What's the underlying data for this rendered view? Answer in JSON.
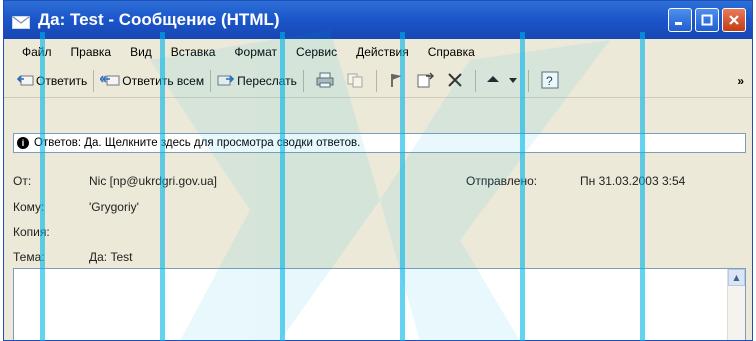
{
  "window": {
    "title": "Да: Test - Сообщение (HTML)"
  },
  "menu": [
    {
      "label": "Файл"
    },
    {
      "label": "Правка"
    },
    {
      "label": "Вид"
    },
    {
      "label": "Вставка"
    },
    {
      "label": "Формат"
    },
    {
      "label": "Сервис"
    },
    {
      "label": "Действия"
    },
    {
      "label": "Справка"
    }
  ],
  "toolbar": {
    "reply": "Ответить",
    "reply_all": "Ответить всем",
    "forward": "Переслать",
    "more": "»"
  },
  "info_bar": {
    "text": "Ответов: Да. Щелкните здесь для просмотра сводки ответов."
  },
  "header": {
    "from_label": "От:",
    "from_value": "Nic [np@ukrdgri.gov.ua]",
    "sent_label": "Отправлено:",
    "sent_value": "Пн 31.03.2003 3:54",
    "to_label": "Кому:",
    "to_value": "'Grygoriy'",
    "cc_label": "Копия:",
    "cc_value": "",
    "subject_label": "Тема:",
    "subject_value": "Да: Test"
  },
  "colors": {
    "titlebar": "#1b55c9",
    "window_bg": "#ece9d8",
    "watermark": "#00b4e8"
  }
}
